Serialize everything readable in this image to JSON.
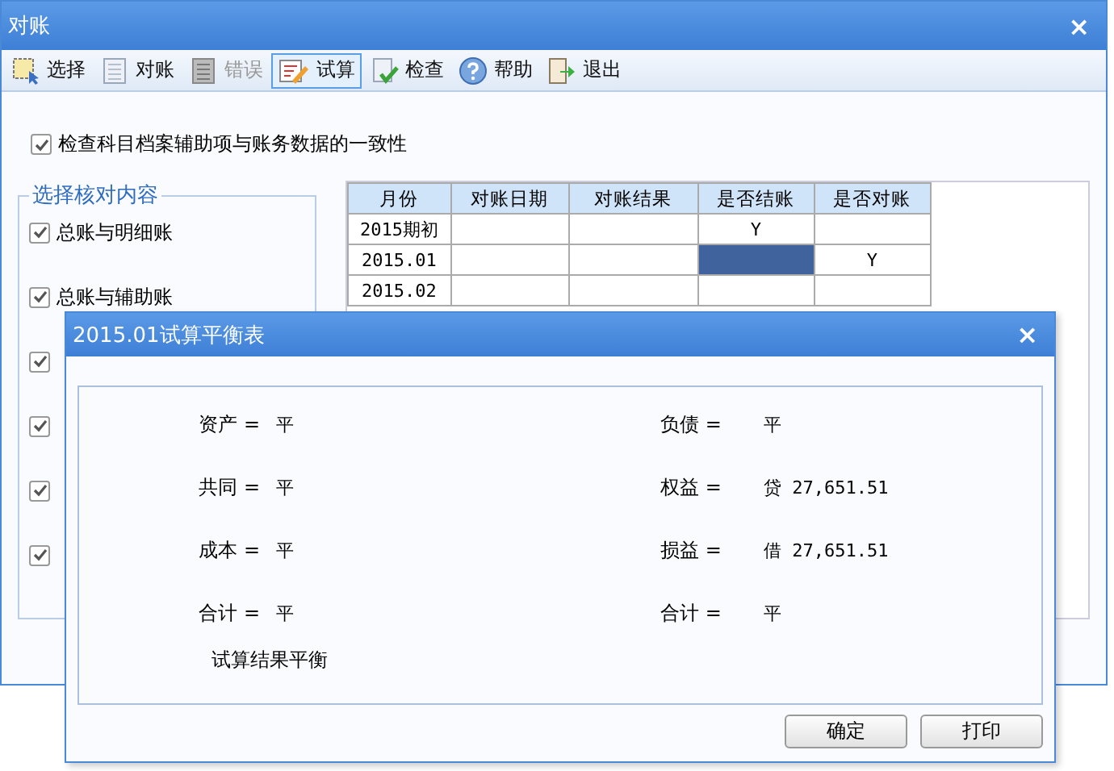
{
  "window": {
    "title": "对账",
    "close": "×"
  },
  "toolbar": [
    {
      "label": "选择",
      "disabled": false,
      "selected": false
    },
    {
      "label": "对账",
      "disabled": false,
      "selected": false
    },
    {
      "label": "错误",
      "disabled": true,
      "selected": false
    },
    {
      "label": "试算",
      "disabled": false,
      "selected": true
    },
    {
      "label": "检查",
      "disabled": false,
      "selected": false
    },
    {
      "label": "帮助",
      "disabled": false,
      "selected": false
    },
    {
      "label": "退出",
      "disabled": false,
      "selected": false
    }
  ],
  "consistency_check": {
    "label": "检查科目档案辅助项与账务数据的一致性",
    "checked": true
  },
  "options": {
    "title": "选择核对内容",
    "items": [
      {
        "label": "总账与明细账",
        "checked": true
      },
      {
        "label": "总账与辅助账",
        "checked": true
      },
      {
        "checked": true
      },
      {
        "checked": true
      },
      {
        "checked": true
      },
      {
        "checked": true
      }
    ]
  },
  "table": {
    "columns": [
      "月份",
      "对账日期",
      "对账结果",
      "是否结账",
      "是否对账"
    ],
    "rows": [
      {
        "cells": [
          {
            "text": "2015期初",
            "selected": false
          },
          {
            "selected": false
          },
          {
            "selected": false
          },
          {
            "text": "Y",
            "selected": false
          },
          {
            "selected": false
          }
        ]
      },
      {
        "cells": [
          {
            "text": "2015.01",
            "selected": false
          },
          {
            "selected": false
          },
          {
            "selected": false
          },
          {
            "selected": true
          },
          {
            "text": "Y",
            "selected": false
          }
        ]
      },
      {
        "cells": [
          {
            "text": "2015.02",
            "selected": false
          },
          {
            "selected": false
          },
          {
            "selected": false
          },
          {
            "selected": false
          },
          {
            "selected": false
          }
        ]
      }
    ]
  },
  "dialog": {
    "title": "2015.01试算平衡表",
    "close": "×",
    "left": [
      {
        "label": "资产 =",
        "value": "平"
      },
      {
        "label": "共同 =",
        "value": "平"
      },
      {
        "label": "成本 =",
        "value": "平"
      },
      {
        "label": "合计 =",
        "value": "平"
      }
    ],
    "right": [
      {
        "label": "负债 =",
        "value": "平"
      },
      {
        "label": "权益 =",
        "value": "贷 27,651.51"
      },
      {
        "label": "损益 =",
        "value": "借 27,651.51"
      },
      {
        "label": "合计 =",
        "value": "平"
      }
    ],
    "result": "试算结果平衡",
    "buttons": [
      "确定",
      "打印"
    ]
  }
}
